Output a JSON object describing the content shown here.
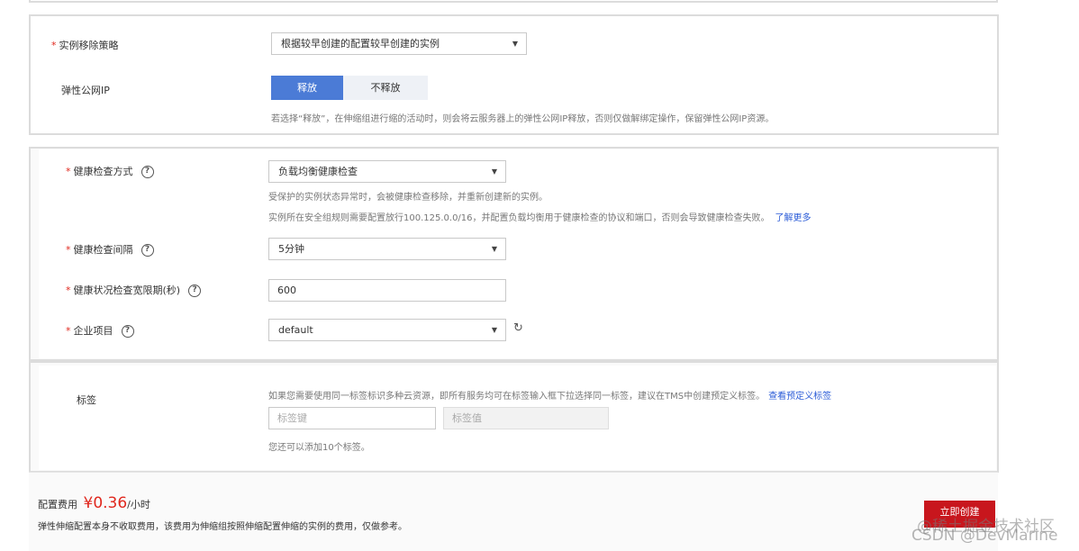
{
  "removal": {
    "label": "实例移除策略",
    "value": "根据较早创建的配置较早创建的实例"
  },
  "eip": {
    "label": "弹性公网IP",
    "release_label": "释放",
    "no_release_label": "不释放",
    "selected": "释放",
    "hint": "若选择“释放”，在伸缩组进行缩的活动时，则会将云服务器上的弹性公网IP释放，否则仅做解绑定操作，保留弹性公网IP资源。"
  },
  "health_mode": {
    "label": "健康检查方式",
    "value": "负载均衡健康检查",
    "hint1": "受保护的实例状态异常时，会被健康检查移除，并重新创建新的实例。",
    "hint2": "实例所在安全组规则需要配置放行100.125.0.0/16，并配置负载均衡用于健康检查的协议和端口，否则会导致健康检查失败。",
    "link": "了解更多"
  },
  "health_interval": {
    "label": "健康检查间隔",
    "value": "5分钟"
  },
  "grace_period": {
    "label": "健康状况检查宽限期(秒)",
    "value": "600"
  },
  "enterprise_project": {
    "label": "企业项目",
    "value": "default"
  },
  "tags": {
    "label": "标签",
    "hint": "如果您需要使用同一标签标识多种云资源，即所有服务均可在标签输入框下拉选择同一标签，建议在TMS中创建预定义标签。",
    "link": "查看预定义标签",
    "key_placeholder": "标签键",
    "value_placeholder": "标签值",
    "remaining": "您还可以添加10个标签。"
  },
  "footer": {
    "cost_label": "配置费用",
    "price": "¥0.36",
    "unit": "/小时",
    "note": "弹性伸缩配置本身不收取费用，该费用为伸缩组按照伸缩配置伸缩的实例的费用，仅做参考。",
    "create_button": "立即创建"
  },
  "watermark": {
    "line1": "@稀土掘金技术社区",
    "line2": "CSDN @DevMarine"
  },
  "icons": {
    "help": "?",
    "dropdown": "▼",
    "refresh": "↻"
  },
  "colors": {
    "accent": "#4b7bd6",
    "required": "#e0281e",
    "create_button": "#c8161d",
    "link": "#2a5bd7"
  }
}
